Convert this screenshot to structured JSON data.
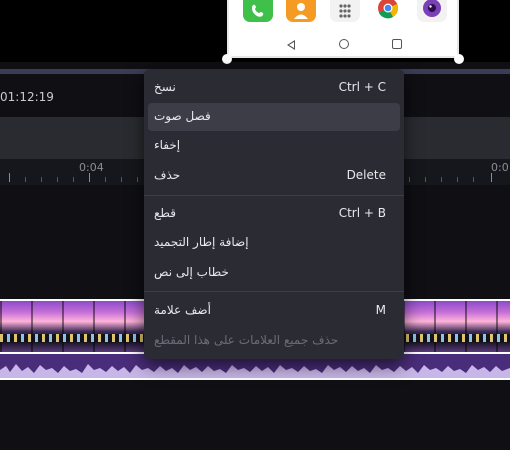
{
  "preview": {
    "apps": [
      {
        "icon": "phone-icon",
        "color": "#3ec04b"
      },
      {
        "icon": "contacts-icon",
        "color": "#f59a23"
      },
      {
        "icon": "app-drawer-icon",
        "color": "#f2f2f2"
      },
      {
        "icon": "chrome-icon",
        "color": "#4285f4"
      },
      {
        "icon": "camera-icon",
        "color": "#7b3fb8"
      }
    ]
  },
  "timeline": {
    "timecode": "01:12:19",
    "ruler_labels": [
      "0:04",
      "0:0"
    ]
  },
  "context_menu": {
    "items": [
      {
        "label": "نسخ",
        "shortcut": "Ctrl + C"
      },
      {
        "label": "فصل صوت",
        "shortcut": ""
      },
      {
        "label": "إخفاء",
        "shortcut": ""
      },
      {
        "label": "حذف",
        "shortcut": "Delete"
      },
      {
        "label": "قطع",
        "shortcut": "Ctrl + B"
      },
      {
        "label": "إضافة إطار التجميد",
        "shortcut": ""
      },
      {
        "label": "خطاب إلى نص",
        "shortcut": ""
      },
      {
        "label": "أضف علامة",
        "shortcut": "M"
      },
      {
        "label": "حذف جميع العلامات على هذا المقطع",
        "shortcut": ""
      }
    ]
  }
}
